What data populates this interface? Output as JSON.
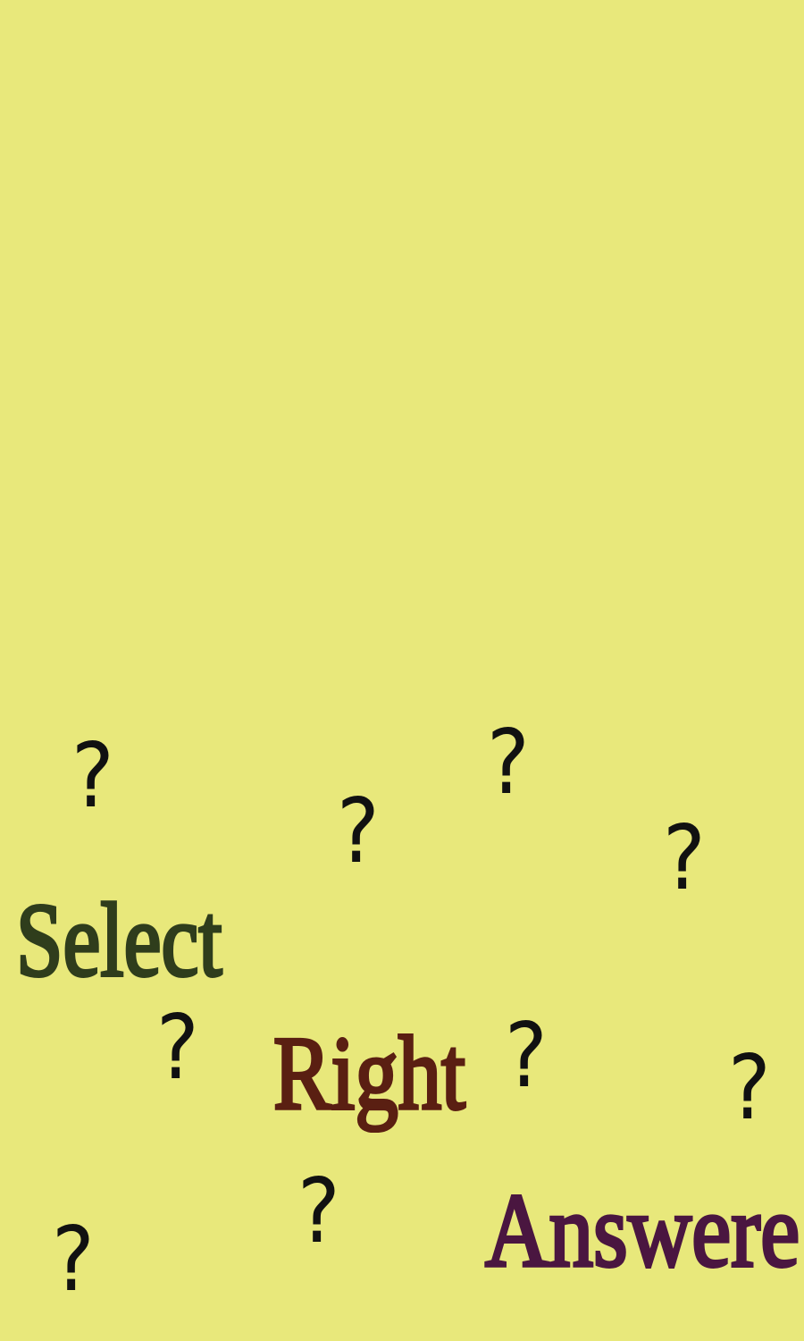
{
  "screen": {
    "background_color": "#e8e87b"
  },
  "question_marks": [
    {
      "glyph": "?",
      "icon": "question-mark-icon"
    },
    {
      "glyph": "?",
      "icon": "question-mark-icon"
    },
    {
      "glyph": "?",
      "icon": "question-mark-icon"
    },
    {
      "glyph": "?",
      "icon": "question-mark-icon"
    },
    {
      "glyph": "?",
      "icon": "question-mark-icon"
    },
    {
      "glyph": "?",
      "icon": "question-mark-icon"
    },
    {
      "glyph": "?",
      "icon": "question-mark-icon"
    },
    {
      "glyph": "?",
      "icon": "question-mark-icon"
    },
    {
      "glyph": "?",
      "icon": "question-mark-icon"
    }
  ],
  "words": {
    "select": {
      "text": "Select",
      "fill_color": "#e8e87b",
      "outline_color": "#2f3d1c"
    },
    "right": {
      "text": "Right",
      "fill_color": "#e8e87b",
      "outline_color": "#5a1f12"
    },
    "answer": {
      "text": "Answere",
      "fill_color": "#e8e87b",
      "outline_color": "#4a1640"
    }
  }
}
